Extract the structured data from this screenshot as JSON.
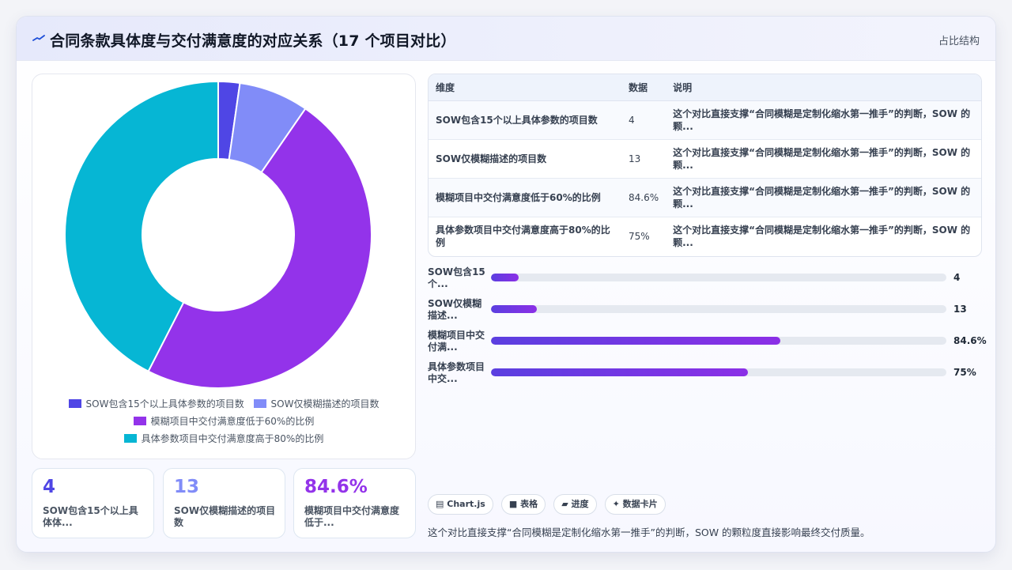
{
  "header": {
    "title": "合同条款具体度与交付满意度的对应关系（17 个项目对比）",
    "right_label": "占比结构"
  },
  "colors": {
    "indigo": "#4f46e5",
    "periwinkle": "#818cf8",
    "purple": "#9333ea",
    "cyan": "#06b6d4"
  },
  "chart_data": {
    "type": "pie",
    "categories": [
      "SOW包含15个以上具体参数的项目数",
      "SOW仅模糊描述的项目数",
      "模糊项目中交付满意度低于60%的比例",
      "具体参数项目中交付满意度高于80%的比例"
    ],
    "values": [
      4,
      13,
      84.6,
      75
    ],
    "colors": [
      "#4f46e5",
      "#818cf8",
      "#9333ea",
      "#06b6d4"
    ],
    "legend": "bottom"
  },
  "legend": [
    "SOW包含15个以上具体参数的项目数",
    "SOW仅模糊描述的项目数",
    "模糊项目中交付满意度低于60%的比例",
    "具体参数项目中交付满意度高于80%的比例"
  ],
  "stats": [
    {
      "value": "4",
      "label": "SOW包含15个以上具体体...",
      "color": "#4f46e5"
    },
    {
      "value": "13",
      "label": "SOW仅模糊描述的项目数",
      "color": "#818cf8"
    },
    {
      "value": "84.6%",
      "label": "模糊项目中交付满意度低于...",
      "color": "#9333ea"
    }
  ],
  "table": {
    "headers": [
      "维度",
      "数据",
      "说明"
    ],
    "rows": [
      {
        "dimension": "SOW包含15个以上具体参数的项目数",
        "value": "4",
        "note": "这个对比直接支撑“合同模糊是定制化缩水第一推手”的判断，SOW 的颗..."
      },
      {
        "dimension": "SOW仅模糊描述的项目数",
        "value": "13",
        "note": "这个对比直接支撑“合同模糊是定制化缩水第一推手”的判断，SOW 的颗..."
      },
      {
        "dimension": "模糊项目中交付满意度低于60%的比例",
        "value": "84.6%",
        "note": "这个对比直接支撑“合同模糊是定制化缩水第一推手”的判断，SOW 的颗..."
      },
      {
        "dimension": "具体参数项目中交付满意度高于80%的比例",
        "value": "75%",
        "note": "这个对比直接支撑“合同模糊是定制化缩水第一推手”的判断，SOW 的颗..."
      }
    ]
  },
  "bars": [
    {
      "label": "SOW包含15个...",
      "value": "4",
      "fraction": 0.06
    },
    {
      "label": "SOW仅模糊描述...",
      "value": "13",
      "fraction": 0.1
    },
    {
      "label": "模糊项目中交付满...",
      "value": "84.6%",
      "fraction": 0.635
    },
    {
      "label": "具体参数项目中交...",
      "value": "75%",
      "fraction": 0.565
    }
  ],
  "tags": [
    "Chart.js",
    "表格",
    "进度",
    "数据卡片"
  ],
  "footnote": "这个对比直接支撑“合同模糊是定制化缩水第一推手”的判断，SOW 的颗粒度直接影响最终交付质量。"
}
